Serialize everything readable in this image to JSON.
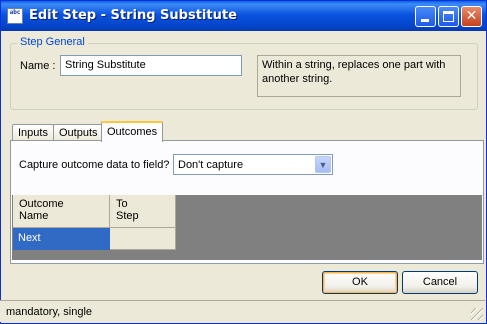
{
  "window": {
    "title": "Edit Step - String Substitute",
    "app_icon": "abc",
    "icon_name": "abc-string-icon"
  },
  "step_general": {
    "legend": "Step General",
    "name_label": "Name :",
    "name_value": "String Substitute",
    "description": "Within a string, replaces one part with another string."
  },
  "tabs": [
    {
      "label": "Inputs",
      "active": false
    },
    {
      "label": "Outputs",
      "active": false
    },
    {
      "label": "Outcomes",
      "active": true
    }
  ],
  "outcomes": {
    "capture_label": "Capture outcome data to field?",
    "capture_value": "Don't capture",
    "columns": [
      {
        "line1": "Outcome",
        "line2": "Name"
      },
      {
        "line1": "To",
        "line2": "Step"
      }
    ],
    "rows": [
      {
        "outcome_name": "Next",
        "to_step": ""
      }
    ]
  },
  "buttons": {
    "ok": "OK",
    "cancel": "Cancel"
  },
  "status": {
    "text": "mandatory, single"
  },
  "colors": {
    "title_bar": "#0a54e0",
    "selection": "#316ac5",
    "legend_text": "#0046d5",
    "grid_background": "#808080"
  }
}
